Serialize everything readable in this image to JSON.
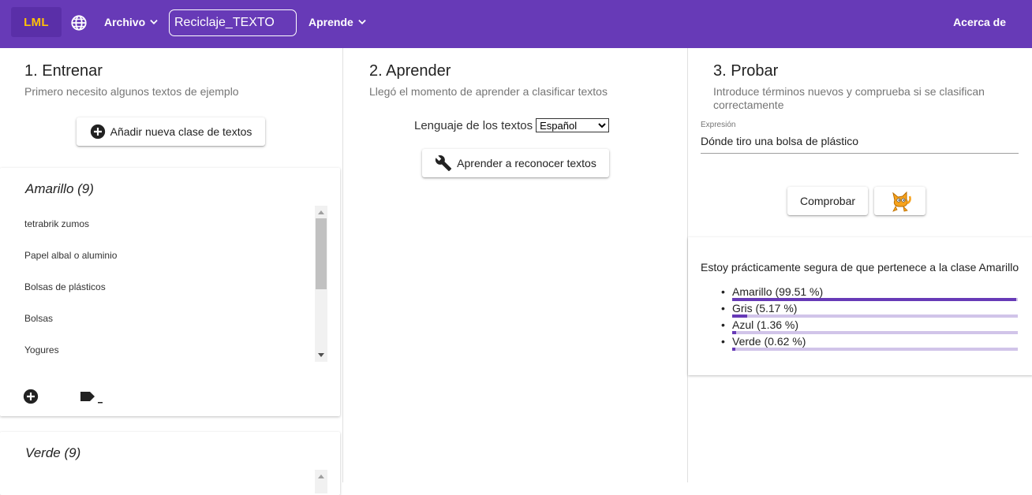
{
  "topbar": {
    "logo": "LML",
    "archivo_label": "Archivo",
    "project_name": "Reciclaje_TEXTO",
    "aprende_label": "Aprende",
    "about_label": "Acerca de"
  },
  "train": {
    "title": "1. Entrenar",
    "subtitle": "Primero necesito algunos textos de ejemplo",
    "add_class_label": "Añadir nueva clase de textos",
    "classes": [
      {
        "title": "Amarillo (9)",
        "items": [
          "tetrabrik zumos",
          "Papel albal o aluminio",
          "Bolsas de plásticos",
          "Bolsas",
          "Yogures"
        ]
      },
      {
        "title": "Verde (9)",
        "items": []
      }
    ]
  },
  "learn": {
    "title": "2. Aprender",
    "subtitle": "Llegó el momento de aprender a clasificar textos",
    "language_label": "Lenguaje de los textos",
    "language_value": "Español",
    "learn_button_label": "Aprender a reconocer textos"
  },
  "test": {
    "title": "3. Probar",
    "subtitle": "Introduce términos nuevos y comprueba si se clasifican correctamente",
    "expression_label": "Expresión",
    "expression_value": "Dónde tiro una bolsa de plástico",
    "check_button_label": "Comprobar",
    "result_text": "Estoy prácticamente segura de que pertenece a la clase Amarillo",
    "results": [
      {
        "label": "Amarillo (99.51 %)",
        "fraction": 0.9951
      },
      {
        "label": "Gris (5.17 %)",
        "fraction": 0.0517
      },
      {
        "label": "Azul (1.36 %)",
        "fraction": 0.0136
      },
      {
        "label": "Verde (0.62 %)",
        "fraction": 0.0062
      }
    ]
  },
  "colors": {
    "primary": "#673ab7",
    "logo_text": "#ffc107",
    "bar_bg": "#d1c4e9"
  }
}
